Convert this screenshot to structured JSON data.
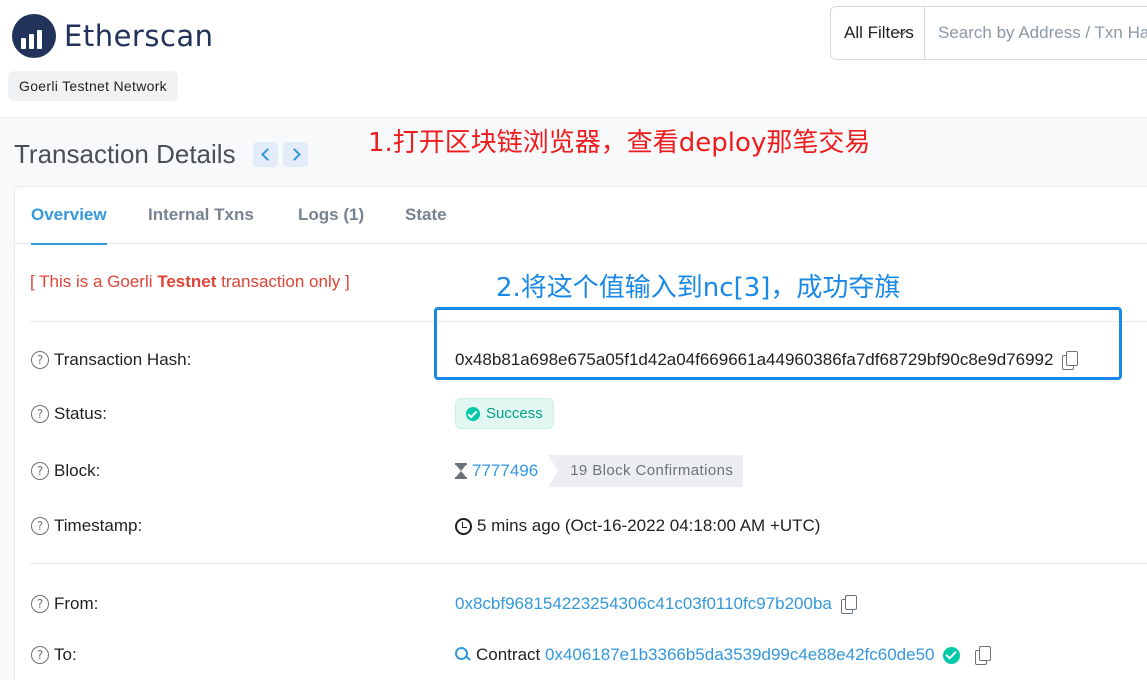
{
  "header": {
    "brand": "Etherscan",
    "network": "Goerli Testnet Network",
    "filter_label": "All Filters",
    "search_placeholder": "Search by Address / Txn Hash / Block / Token"
  },
  "page": {
    "title": "Transaction Details"
  },
  "annotations": {
    "step1": "1.打开区块链浏览器，查看deploy那笔交易",
    "step2": "2.将这个值输入到nc[3]，成功夺旗"
  },
  "tabs": [
    {
      "label": "Overview",
      "active": true
    },
    {
      "label": "Internal Txns",
      "active": false
    },
    {
      "label": "Logs (1)",
      "active": false
    },
    {
      "label": "State",
      "active": false
    }
  ],
  "notice": {
    "prefix": "[ This is a Goerli ",
    "bold": "Testnet",
    "suffix": " transaction only ]"
  },
  "details": {
    "hash_label": "Transaction Hash:",
    "hash_value": "0x48b81a698e675a05f1d42a04f669661a44960386fa7df68729bf90c8e9d76992",
    "status_label": "Status:",
    "status_value": "Success",
    "block_label": "Block:",
    "block_value": "7777496",
    "block_confirmations": "19 Block Confirmations",
    "timestamp_label": "Timestamp:",
    "timestamp_value": "5 mins ago (Oct-16-2022 04:18:00 AM +UTC)",
    "from_label": "From:",
    "from_value": "0x8cbf968154223254306c41c03f0110fc97b200ba",
    "to_label": "To:",
    "to_prefix": "Contract",
    "to_value": "0x406187e1b3366b5da3539d99c4e88e42fc60de50"
  },
  "colors": {
    "accent": "#3498db",
    "success": "#00c9a7",
    "annotation_red": "#ee1c1c",
    "annotation_blue": "#1a88e6",
    "brand": "#21325b"
  }
}
